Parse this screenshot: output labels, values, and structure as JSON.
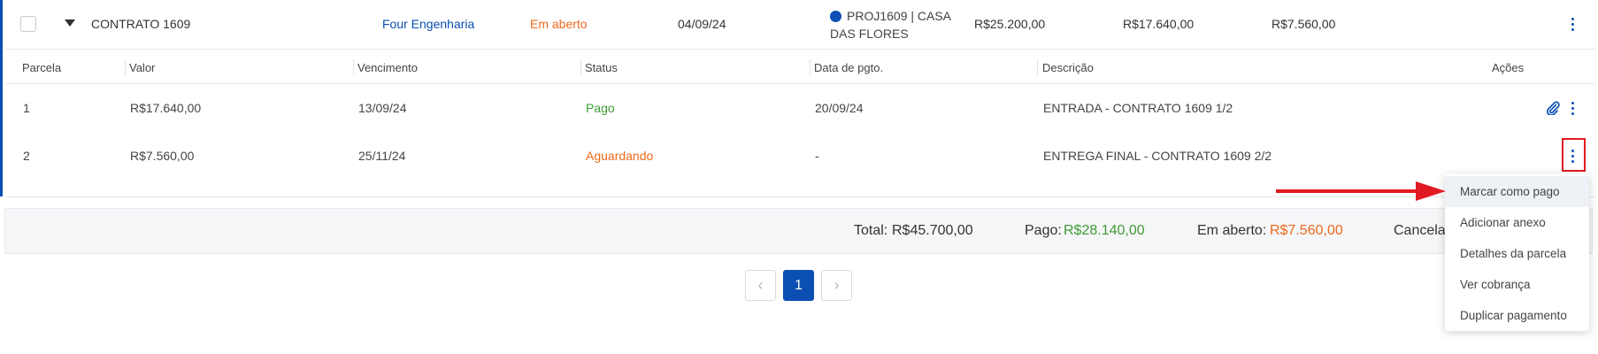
{
  "contract": {
    "name": "CONTRATO 1609",
    "client": "Four Engenharia",
    "status": "Em aberto",
    "date": "04/09/24",
    "project_line1": "PROJ1609 | CASA",
    "project_line2": "DAS FLORES",
    "total": "R$25.200,00",
    "paid": "R$17.640,00",
    "open": "R$7.560,00"
  },
  "table": {
    "headers": [
      "Parcela",
      "Valor",
      "Vencimento",
      "Status",
      "Data de pgto.",
      "Descrição",
      "Ações"
    ],
    "rows": [
      {
        "parcela": "1",
        "valor": "R$17.640,00",
        "vencimento": "13/09/24",
        "status": "Pago",
        "data_pgto": "20/09/24",
        "descricao": "ENTRADA - CONTRATO 1609 1/2"
      },
      {
        "parcela": "2",
        "valor": "R$7.560,00",
        "vencimento": "25/11/24",
        "status": "Aguardando",
        "data_pgto": "-",
        "descricao": "ENTREGA FINAL - CONTRATO 1609 2/2"
      }
    ]
  },
  "totals": {
    "total_label": "Total:",
    "total_value": "R$45.700,00",
    "pago_label": "Pago:",
    "pago_value": "R$28.140,00",
    "aberto_label": "Em aberto:",
    "aberto_value": "R$7.560,00",
    "cancel_label": "Cancela"
  },
  "pagination": {
    "prev": "‹",
    "current": "1",
    "next": "›"
  },
  "menu": {
    "items": [
      "Marcar como pago",
      "Adicionar anexo",
      "Detalhes da parcela",
      "Ver cobrança",
      "Duplicar pagamento"
    ]
  },
  "colors": {
    "accent": "#0b4fb3",
    "paid": "#3f9c35",
    "pending": "#ee6a1c",
    "annotation": "#e11b22"
  },
  "icons": {
    "expand": "caret-down-icon",
    "project": "dot-icon",
    "actions": "kebab-icon",
    "attachment": "paperclip-icon"
  }
}
